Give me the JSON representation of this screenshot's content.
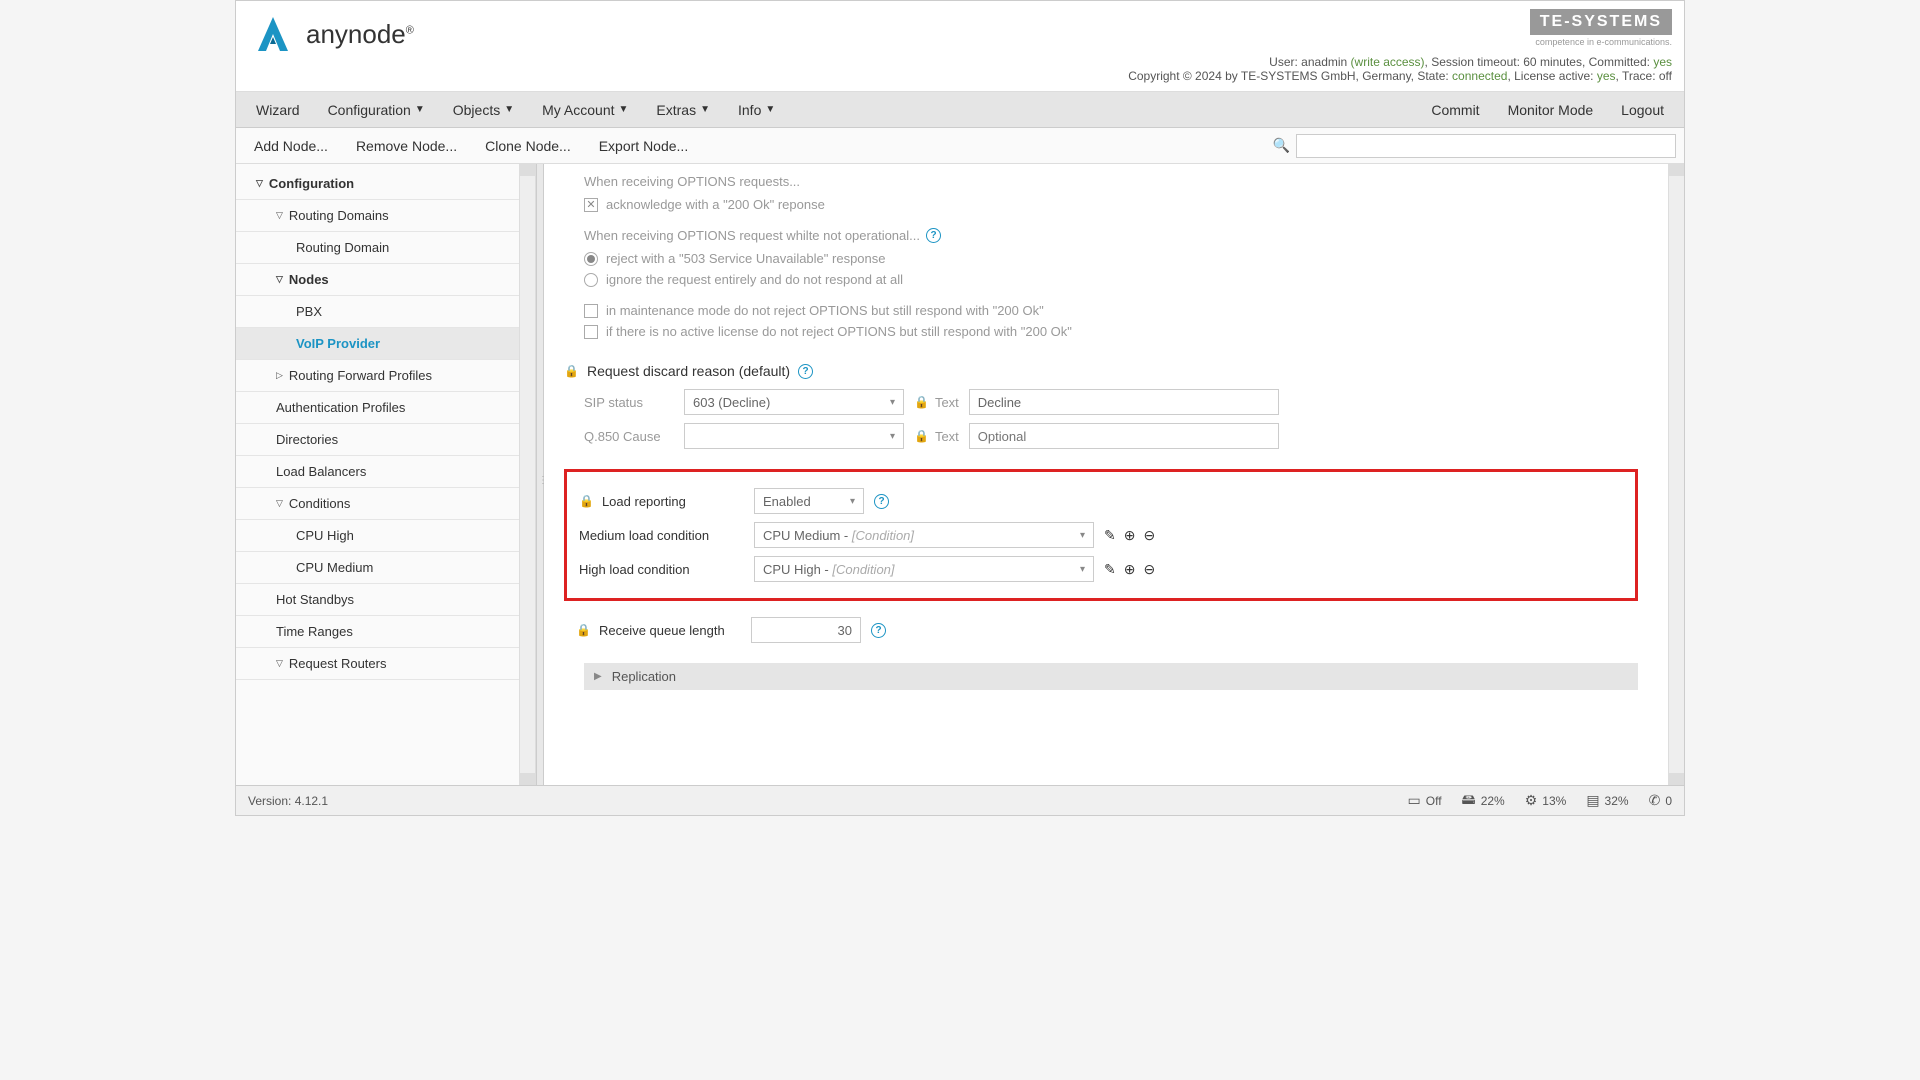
{
  "header": {
    "logo_text": "anynode",
    "logo_tm": "®",
    "te_logo": "TE-SYSTEMS",
    "te_sub": "competence in e-communications.",
    "user_prefix": "User: ",
    "user_name": "anadmin",
    "user_access": " (write access)",
    "session": ", Session timeout: 60 minutes, Committed: ",
    "committed": "yes",
    "copyright": "Copyright © 2024 by TE-SYSTEMS GmbH, Germany, State: ",
    "state": "connected",
    "license_prefix": ", License active: ",
    "license": "yes",
    "trace": ", Trace: off"
  },
  "menubar": {
    "wizard": "Wizard",
    "configuration": "Configuration",
    "objects": "Objects",
    "my_account": "My Account",
    "extras": "Extras",
    "info": "Info",
    "commit": "Commit",
    "monitor": "Monitor Mode",
    "logout": "Logout"
  },
  "toolbar": {
    "add_node": "Add Node...",
    "remove_node": "Remove Node...",
    "clone_node": "Clone Node...",
    "export_node": "Export Node...",
    "search_placeholder": ""
  },
  "sidebar": {
    "configuration": "Configuration",
    "routing_domains": "Routing Domains",
    "routing_domain": "Routing Domain",
    "nodes": "Nodes",
    "pbx": "PBX",
    "voip_provider": "VoIP Provider",
    "routing_forward": "Routing Forward Profiles",
    "auth_profiles": "Authentication Profiles",
    "directories": "Directories",
    "load_balancers": "Load Balancers",
    "conditions": "Conditions",
    "cpu_high": "CPU High",
    "cpu_medium": "CPU Medium",
    "hot_standbys": "Hot Standbys",
    "time_ranges": "Time Ranges",
    "request_routers": "Request Routers"
  },
  "content": {
    "options_heading": "When receiving OPTIONS requests...",
    "ack_200": "acknowledge with a \"200 Ok\" reponse",
    "not_operational": "When receiving OPTIONS request whilte not operational...",
    "reject_503": "reject with a \"503 Service Unavailable\" response",
    "ignore_request": "ignore the request entirely and do not respond at all",
    "maintenance_mode": "in maintenance mode do not reject OPTIONS but still respond with \"200 Ok\"",
    "no_license": "if there is no active license do not reject OPTIONS but still respond with \"200 Ok\"",
    "discard_title": "Request discard reason (default)",
    "sip_status_label": "SIP status",
    "sip_status_value": "603 (Decline)",
    "text_label": "Text",
    "decline_value": "Decline",
    "q850_label": "Q.850 Cause",
    "optional_placeholder": "Optional",
    "load_reporting": "Load reporting",
    "load_reporting_value": "Enabled",
    "medium_load_label": "Medium load condition",
    "medium_load_value": "CPU Medium - ",
    "medium_load_suffix": "[Condition]",
    "high_load_label": "High load condition",
    "high_load_value": "CPU High - ",
    "high_load_suffix": "[Condition]",
    "queue_length_label": "Receive queue length",
    "queue_length_value": "30",
    "replication": "Replication"
  },
  "footer": {
    "version": "Version: 4.12.1",
    "off": "Off",
    "disk": "22%",
    "cpu": "13%",
    "mem": "32%",
    "calls": "0"
  }
}
